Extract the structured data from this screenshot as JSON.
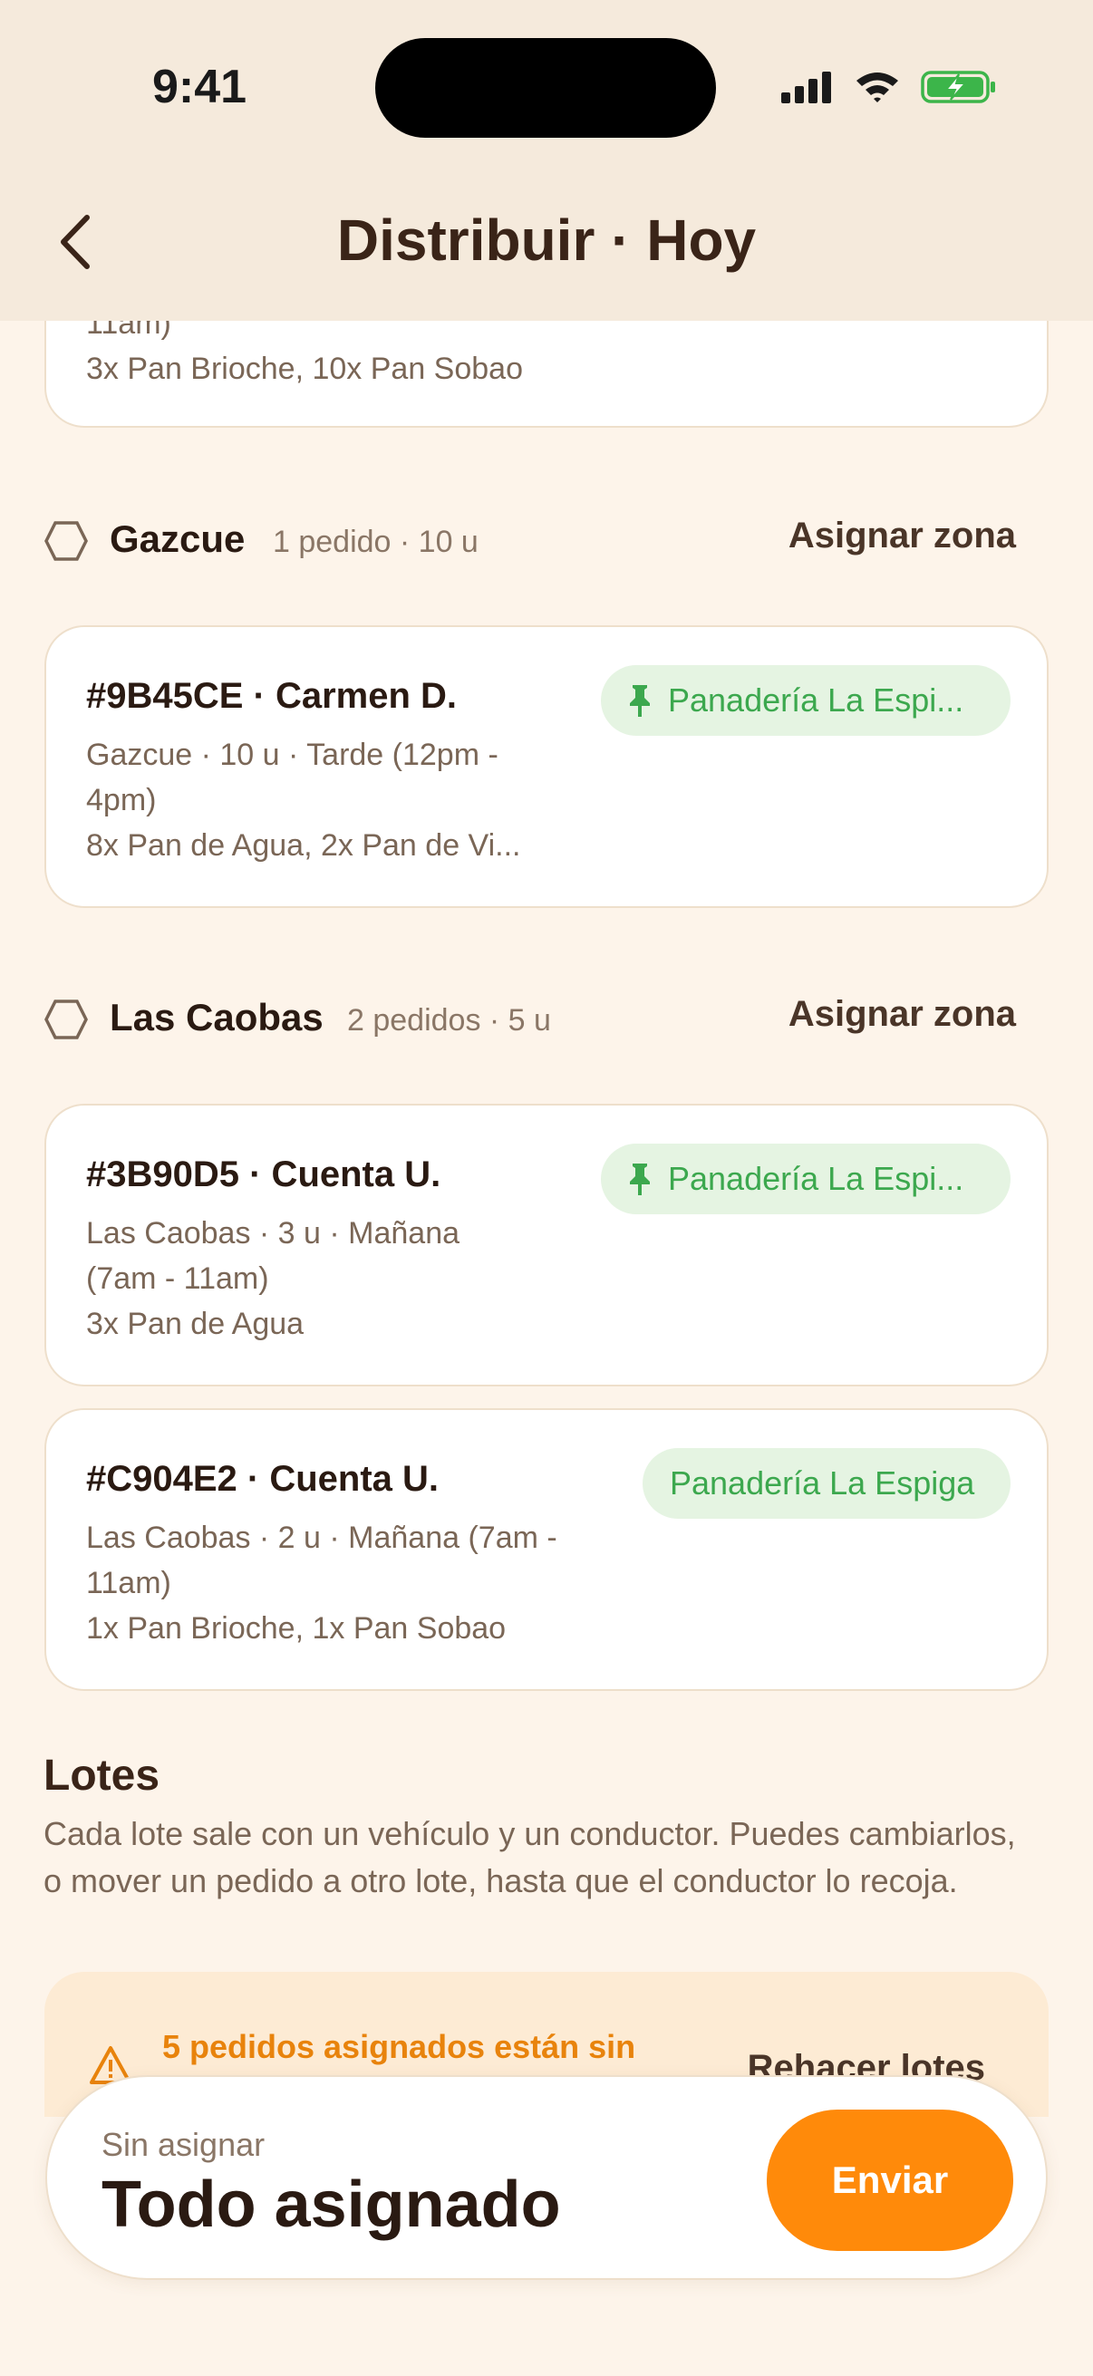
{
  "status_bar": {
    "time": "9:41"
  },
  "nav": {
    "title": "Distribuir · Hoy"
  },
  "top_card": {
    "line_partial": "11am)",
    "items": "3x Pan Brioche, 10x Pan Sobao"
  },
  "zones": [
    {
      "name": "Gazcue",
      "meta": "1 pedido · 10 u",
      "action": "Asignar zona",
      "orders": [
        {
          "title": "#9B45CE · Carmen D.",
          "line1": "Gazcue · 10 u · Tarde (12pm -",
          "line2": "4pm)",
          "items": "8x Pan de Agua, 2x Pan de Vi...",
          "bakery": "Panadería La Espi...",
          "pinned": true
        }
      ]
    },
    {
      "name": "Las Caobas",
      "meta": "2 pedidos · 5 u",
      "action": "Asignar zona",
      "orders": [
        {
          "title": "#3B90D5 · Cuenta U.",
          "line1": "Las Caobas · 3 u · Mañana",
          "line2": "(7am - 11am)",
          "items": "3x Pan de Agua",
          "bakery": "Panadería La Espi...",
          "pinned": true
        },
        {
          "title": "#C904E2 · Cuenta U.",
          "line1": "Las Caobas · 2 u · Mañana (7am -",
          "line2": "11am)",
          "items": "1x Pan Brioche, 1x Pan Sobao",
          "bakery": "Panadería La Espiga",
          "pinned": false
        }
      ]
    }
  ],
  "lotes": {
    "title": "Lotes",
    "description": "Cada lote sale con un vehículo y un conductor. Puedes cambiarlos, o mover un pedido a otro lote, hasta que el conductor lo recoja."
  },
  "warning": {
    "text": "5 pedidos asignados están sin",
    "action": "Rehacer lotes"
  },
  "bottom_bar": {
    "label": "Sin asignar",
    "value": "Todo asignado",
    "button": "Enviar"
  },
  "colors": {
    "accent": "#FF8A0A",
    "pill_bg": "#E5F4E2",
    "pill_text": "#3CA84E",
    "background": "#FDF4EA",
    "header": "#F5EADC"
  }
}
